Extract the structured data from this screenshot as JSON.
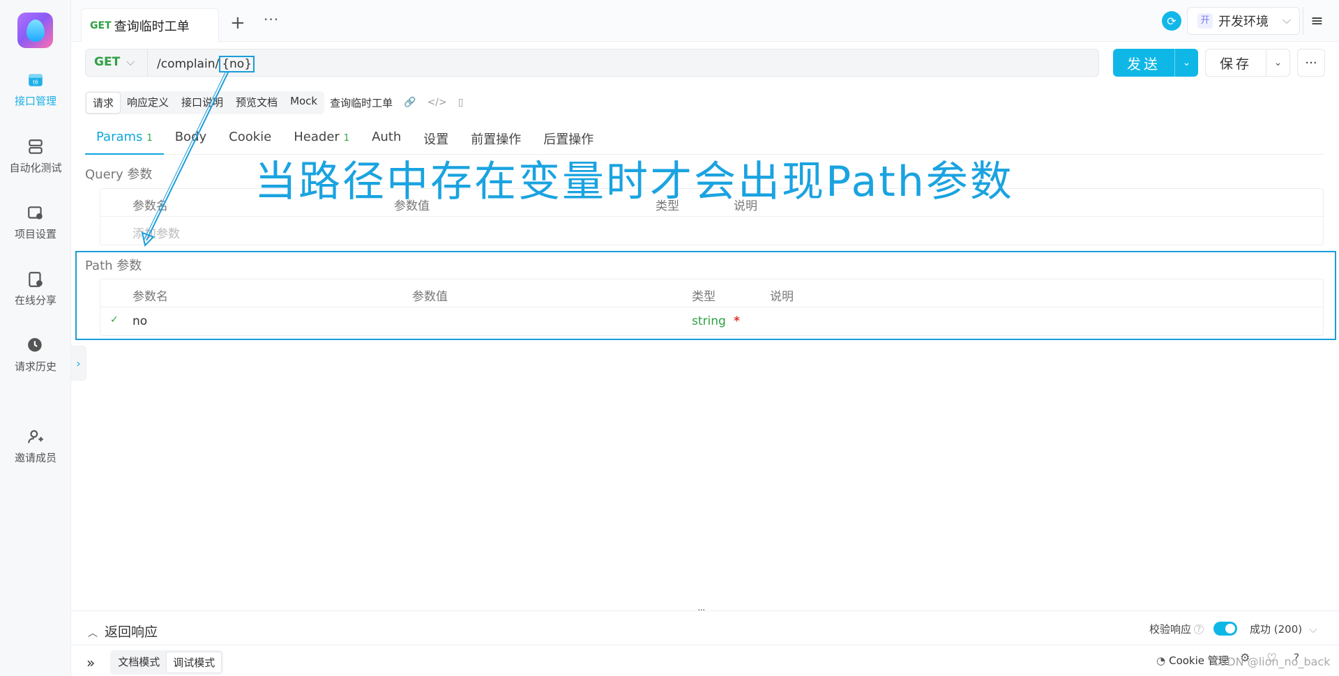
{
  "sidebar": {
    "items": [
      {
        "label": "接口管理",
        "icon": "api-management-icon",
        "active": true
      },
      {
        "label": "自动化测试",
        "icon": "automation-icon",
        "active": false
      },
      {
        "label": "项目设置",
        "icon": "project-settings-icon",
        "active": false
      },
      {
        "label": "在线分享",
        "icon": "online-share-icon",
        "active": false
      },
      {
        "label": "请求历史",
        "icon": "history-icon",
        "active": false
      },
      {
        "label": "邀请成员",
        "icon": "invite-member-icon",
        "active": false
      }
    ]
  },
  "topbar": {
    "tab_method": "GET",
    "tab_title": "查询临时工单",
    "add_label": "+",
    "more_label": "···",
    "env_badge": "开",
    "env_label": "开发环境"
  },
  "request": {
    "method": "GET",
    "url_prefix": "/complain/",
    "url_variable": "{no}",
    "send_label": "发送",
    "save_label": "保存"
  },
  "subtabs": {
    "items": [
      "请求",
      "响应定义",
      "接口说明",
      "预览文档",
      "Mock"
    ],
    "active": "请求",
    "title": "查询临时工单"
  },
  "param_tabs": {
    "items": [
      {
        "label": "Params",
        "count": "1",
        "active": true
      },
      {
        "label": "Body",
        "count": "",
        "active": false
      },
      {
        "label": "Cookie",
        "count": "",
        "active": false
      },
      {
        "label": "Header",
        "count": "1",
        "active": false
      },
      {
        "label": "Auth",
        "count": "",
        "active": false
      },
      {
        "label": "设置",
        "count": "",
        "active": false
      },
      {
        "label": "前置操作",
        "count": "",
        "active": false
      },
      {
        "label": "后置操作",
        "count": "",
        "active": false
      }
    ]
  },
  "query": {
    "label": "Query 参数",
    "headers": [
      "参数名",
      "参数值",
      "类型",
      "说明"
    ],
    "add_placeholder": "添加参数"
  },
  "path": {
    "label": "Path 参数",
    "headers": [
      "参数名",
      "参数值",
      "类型",
      "说明"
    ],
    "rows": [
      {
        "name": "no",
        "value": "",
        "type": "string",
        "required": "*",
        "desc": ""
      }
    ]
  },
  "annotation": "当路径中存在变量时才会出现Path参数",
  "response": {
    "title": "返回响应",
    "validate_label": "校验响应",
    "validate_on": true,
    "status": "成功 (200)"
  },
  "modes": {
    "items": [
      "文档模式",
      "调试模式"
    ],
    "active": "调试模式"
  },
  "footer": {
    "cookie_label": "Cookie 管理",
    "watermark": "CSDN @lion_no_back"
  },
  "colors": {
    "accent": "#0fb7e7",
    "method_get": "#2ea043",
    "annotation": "#1aa3e0"
  }
}
